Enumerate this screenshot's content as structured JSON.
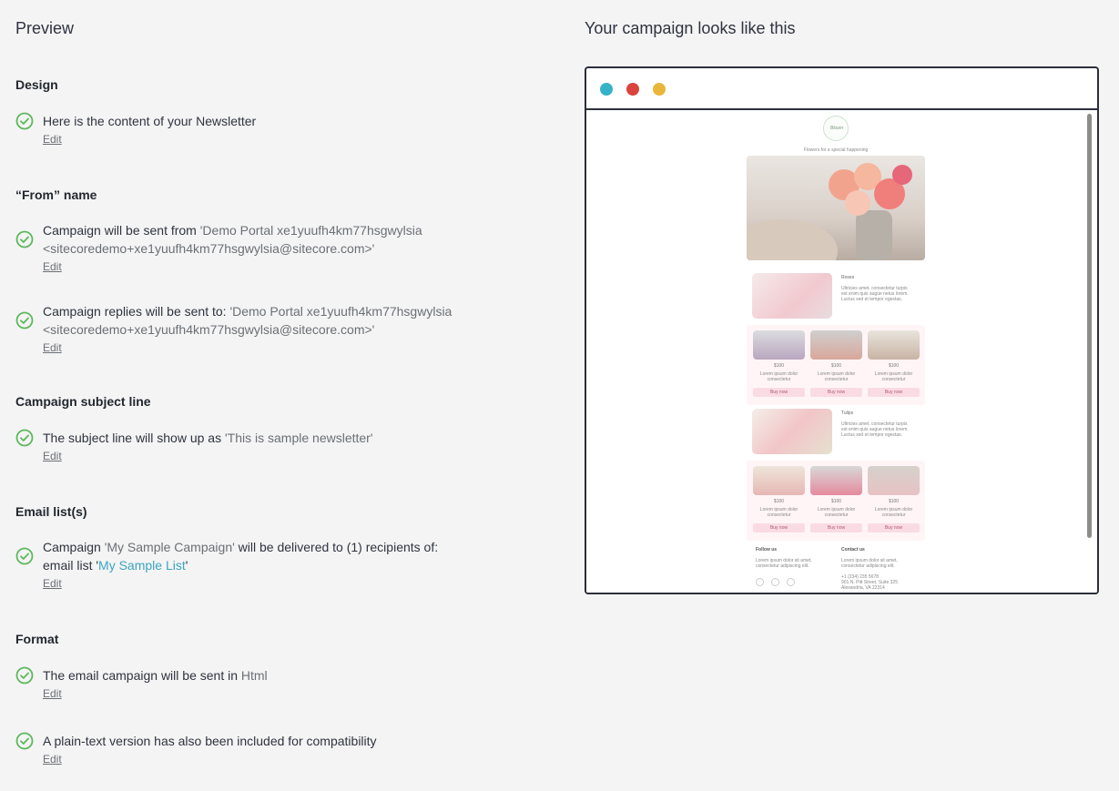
{
  "left": {
    "title": "Preview",
    "sections": {
      "design": {
        "heading": "Design",
        "items": [
          {
            "text": "Here is the content of your Newsletter",
            "edit": "Edit"
          }
        ]
      },
      "from": {
        "heading": "“From” name",
        "items": [
          {
            "text": "Campaign will be sent from ",
            "value": "'Demo Portal xe1yuufh4km77hsgwylsia <sitecoredemo+xe1yuufh4km77hsgwylsia@sitecore.com>'",
            "edit": "Edit"
          },
          {
            "text": "Campaign replies will be sent to: ",
            "value": "'Demo Portal xe1yuufh4km77hsgwylsia <sitecoredemo+xe1yuufh4km77hsgwylsia@sitecore.com>'",
            "edit": "Edit"
          }
        ]
      },
      "subject": {
        "heading": "Campaign subject line",
        "items": [
          {
            "text": "The subject line will show up as ",
            "value": "'This is sample newsletter'",
            "edit": "Edit"
          }
        ]
      },
      "lists": {
        "heading": "Email list(s)",
        "items": [
          {
            "text_a": "Campaign ",
            "value_a": "'My Sample Campaign'",
            "text_b": " will be delivered to (1) recipients of: email list '",
            "link": "My Sample List",
            "text_c": "'",
            "edit": "Edit"
          }
        ]
      },
      "format": {
        "heading": "Format",
        "items": [
          {
            "text": "The email campaign will be sent in ",
            "value": "Html",
            "edit": "Edit"
          },
          {
            "text": "A plain-text version has also been included for compatibility",
            "edit": "Edit"
          }
        ]
      }
    }
  },
  "right": {
    "title": "Your campaign looks like this",
    "email": {
      "logo_text": "Bloom",
      "tagline": "Flowers for a special happening",
      "features": [
        {
          "title": "Roses",
          "text": "Ultricies amet, consectetur turpis est enim quis augue netus lorem. Luctus sed et tempor egestas."
        },
        {
          "title": "Tulips",
          "text": "Ultricies amet, consectetur turpis est enim quis augue netus lorem. Luctus sed et tempor egestas."
        }
      ],
      "price": "$100",
      "product_desc": "Lorem ipsum dolor consectetur",
      "buy_label": "Buy now",
      "footer": {
        "follow_title": "Follow us",
        "follow_text": "Lorem ipsum dolor sit amet, consectetur adipiscing elit.",
        "contact_title": "Contact us",
        "contact_text": "Lorem ipsum dolor sit amet, consectetur adipiscing elit.",
        "phone": "+1 (234) 235 5678",
        "address": "901 N. Pitt Street, Suite 325 Alexandria, VA 22314"
      }
    },
    "colors": {
      "dot_teal": "#36b3c8",
      "dot_red": "#d9443f",
      "dot_yellow": "#e8b63a",
      "check": "#5cb85c",
      "link": "#3aa5bf"
    }
  }
}
